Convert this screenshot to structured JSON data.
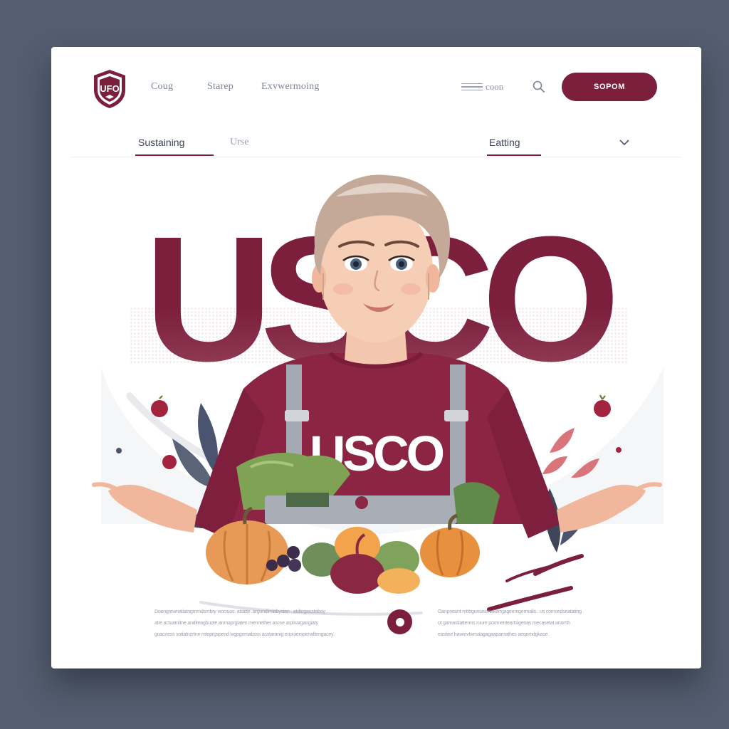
{
  "brand": {
    "logo_text": "UFO",
    "accent": "#7b1f3c",
    "background": "#545e70"
  },
  "nav": {
    "links": [
      "Coug",
      "Starep",
      "Exvwermoing"
    ],
    "menu_label": "coon",
    "cta_label": "SOPOM"
  },
  "subnav": {
    "tabs": [
      "Sustaining",
      "Urse"
    ],
    "right_tab": "Eatting"
  },
  "hero": {
    "headline": "USCO",
    "shirt_text": "USCO"
  },
  "footer": {
    "left_lines": [
      "Doengrewnatiatngmmdsmbry wociuos. atsiitte. argundimiabysian . atdtogaustaboy",
      "at/e actuatnitne anditeagbuote anmaprgiaten mennether ascse arpinargangiaty",
      "guacness sotiatnertne mtoprgspend wgpgemabsss asstaranig enouierspenaftengacey."
    ],
    "right_lines": [
      "Oanpnesnt mttogunsesmakerrgagemngermalis...us comsedseatating",
      "ot garnastiatterms ruure pomnenteartsigenas mecasetat anorrth",
      "eastine hawiovtwrsaagagaaparnathes aeqomdgkase."
    ]
  }
}
